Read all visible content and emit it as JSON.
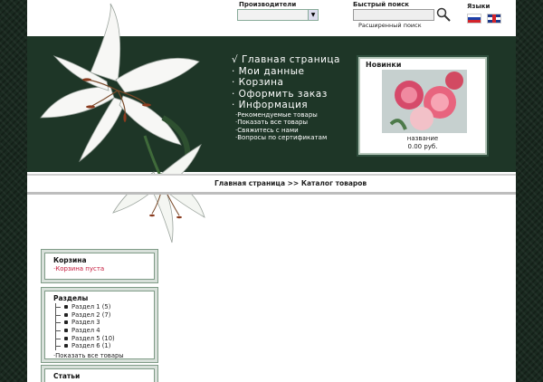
{
  "header": {
    "manufacturers_label": "Производители",
    "quick_search_label": "Быстрый поиск",
    "advanced_search": "Расширенный поиск",
    "languages_label": "Языки",
    "languages": [
      "Russian",
      "English"
    ]
  },
  "nav": {
    "main_items": [
      "√ Главная страница",
      "· Мои данные",
      "· Корзина",
      "· Оформить заказ",
      "· Информация"
    ],
    "info_items": [
      "·Рекомендуемые товары",
      "·Показать все товары",
      "·Свяжитесь с нами",
      "·Вопросы по сертификатам"
    ]
  },
  "new_products": {
    "title": "Новинки",
    "product_name": "название",
    "price": "0.00 руб."
  },
  "breadcrumb": "Главная страница >> Каталог товаров",
  "cart_box": {
    "title": "Корзина",
    "empty_text": "·Корзина пуста"
  },
  "sections_box": {
    "title": "Разделы",
    "items": [
      "Раздел 1 (5)",
      "Раздел 2 (7)",
      "Раздел 3",
      "Раздел 4",
      "Раздел 5 (10)",
      "Раздел 6 (1)"
    ],
    "show_all": "·Показать все товары"
  },
  "articles_box": {
    "title": "Статьи"
  },
  "colors": {
    "band": "#1e3627",
    "accent_red": "#c4183a"
  }
}
